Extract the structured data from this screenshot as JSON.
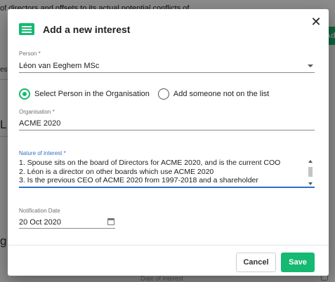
{
  "background": {
    "top_text": "of directors and offsets to its actual potential conflicts of",
    "add_button_label": "Ad",
    "tab_fragment": "est",
    "heading_fragment": "L",
    "heading_fragment_2": "g",
    "bottom_text": "Date of interest"
  },
  "dialog": {
    "title": "Add a new interest",
    "icon": "list-icon",
    "accent_color": "#16b971",
    "focus_color": "#2f6fc6"
  },
  "person": {
    "label": "Person *",
    "value": "Léon van Eeghem MSc"
  },
  "radios": [
    {
      "label": "Select Person in the Organisation",
      "checked": true
    },
    {
      "label": "Add someone not on the list",
      "checked": false
    }
  ],
  "organisation": {
    "label": "Organisation *",
    "value": "ACME 2020"
  },
  "nature": {
    "label": "Nature of interest *",
    "lines": [
      "1. Spouse sits on the board of Directors for ACME 2020, and is the current COO",
      "2. Léon is a director on other boards which use ACME 2020",
      "3. Is the previous CEO of ACME 2020 from 1997-2018 and a shareholder"
    ]
  },
  "notification": {
    "label": "Notification Date",
    "value": "20 Oct 2020"
  },
  "buttons": {
    "cancel": "Cancel",
    "save": "Save"
  }
}
